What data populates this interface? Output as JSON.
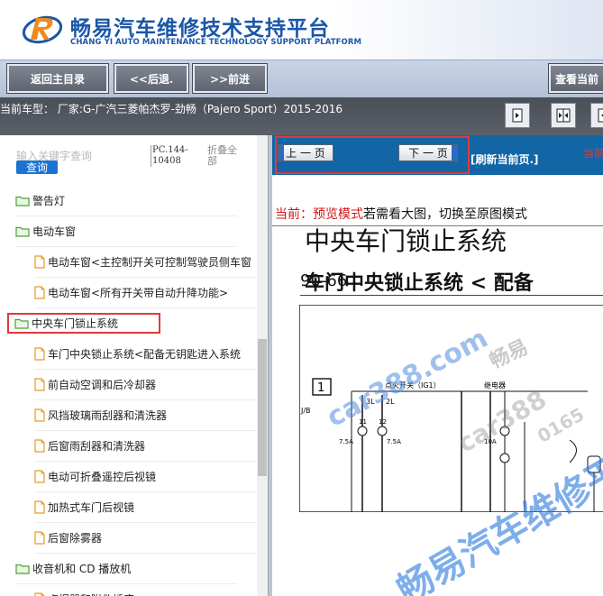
{
  "header": {
    "brand_cn": "畅易汽车维修技术支持平台",
    "brand_en": "CHANG YI AUTO MAINTENANCE TECHNOLOGY SUPPORT PLATFORM",
    "accent_color": "#1a56a8",
    "logo_accent": "#f08a1c"
  },
  "nav": {
    "home": "返回主目录",
    "back": "<<后退.",
    "forward": ">>前进",
    "view_current": "查看当前"
  },
  "info": {
    "model_line": "当前车型：  厂家:G-广汽三菱帕杰罗-劲畅（Pajero Sport）2015-2016"
  },
  "toolbar_icons": [
    "single-page-icon",
    "dual-page-icon",
    "prev-page-icon"
  ],
  "sidebar": {
    "search_placeholder": "输入关键字查询",
    "search_button": "查询",
    "pc_code": "PC.144-10408",
    "collapse_all": "折叠全部",
    "items": [
      {
        "label": "警告灯",
        "type": "folder",
        "level": 0
      },
      {
        "label": "电动车窗",
        "type": "folder",
        "level": 0
      },
      {
        "label": "电动车窗<主控制开关可控制驾驶员侧车窗",
        "type": "doc",
        "level": 1
      },
      {
        "label": "电动车窗<所有开关带自动升降功能>",
        "type": "doc",
        "level": 1
      },
      {
        "label": "中央车门锁止系统",
        "type": "folder",
        "level": 0,
        "selected": true
      },
      {
        "label": "车门中央锁止系统<配备无钥匙进入系统",
        "type": "doc",
        "level": 1
      },
      {
        "label": "前自动空调和后冷却器",
        "type": "doc",
        "level": 1
      },
      {
        "label": "风挡玻璃雨刮器和清洗器",
        "type": "doc",
        "level": 1
      },
      {
        "label": "后窗雨刮器和清洗器",
        "type": "doc",
        "level": 1
      },
      {
        "label": "电动可折叠遥控后视镜",
        "type": "doc",
        "level": 1
      },
      {
        "label": "加热式车门后视镜",
        "type": "doc",
        "level": 1
      },
      {
        "label": "后窗除雾器",
        "type": "doc",
        "level": 1
      },
      {
        "label": "收音机和 CD 播放机",
        "type": "folder",
        "level": 0
      },
      {
        "label": "点烟器和附件插座",
        "type": "doc",
        "level": 1
      }
    ]
  },
  "pager": {
    "prev": "上 一 页",
    "next": "下 一 页",
    "refresh": "[刷新当前页.]",
    "current_label": "当前"
  },
  "mode": {
    "current": "当前：预览模式",
    "hint": "若需看大图，切换至原图模式"
  },
  "document": {
    "page_number": "90-66",
    "title": "中央车门锁止系统",
    "subtitle": "车门中央锁止系统 < 配备",
    "diagram_labels": {
      "box_number": "1",
      "switch_label": "点火开关（IG1）",
      "relay_label": "继电器",
      "connector": "J/B",
      "fuse_1": "3L",
      "fuse_2": "2L",
      "n1": "11",
      "n2": "12",
      "amp_1": "7.5A",
      "amp_2": "7.5A",
      "amp_3": "10A"
    },
    "watermarks": [
      "car388.com",
      "畅易汽车维修平台",
      "畅易",
      "car388",
      "0165"
    ]
  }
}
